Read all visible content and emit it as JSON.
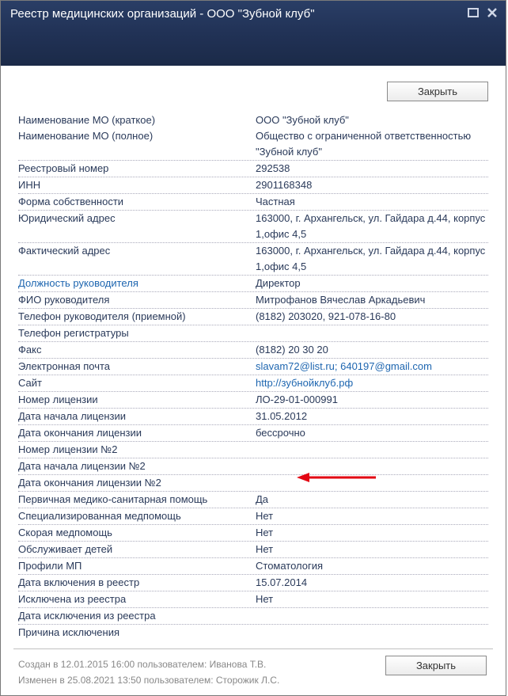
{
  "window": {
    "title": "Реестр медицинских организаций - ООО \"Зубной клуб\""
  },
  "buttons": {
    "close_top": "Закрыть",
    "close_bottom": "Закрыть"
  },
  "rows": {
    "short_name_label": "Наименование МО (краткое)",
    "short_name_value": "ООО \"Зубной клуб\"",
    "full_name_label": "Наименование МО (полное)",
    "full_name_value": "Общество с ограниченной ответственностью \"Зубной клуб\"",
    "reg_num_label": "Реестровый номер",
    "reg_num_value": "292538",
    "inn_label": "ИНН",
    "inn_value": "2901168348",
    "own_form_label": "Форма собственности",
    "own_form_value": "Частная",
    "legal_addr_label": "Юридический адрес",
    "legal_addr_value": "163000, г. Архангельск, ул. Гайдара д.44, корпус 1,офис 4,5",
    "fact_addr_label": "Фактический адрес",
    "fact_addr_value": "163000, г. Архангельск, ул. Гайдара д.44, корпус 1,офис 4,5",
    "chief_pos_label": "Должность руководителя",
    "chief_pos_value": "Директор",
    "chief_name_label": "ФИО руководителя",
    "chief_name_value": "Митрофанов Вячеслав Аркадьевич",
    "chief_phone_label": "Телефон руководителя (приемной)",
    "chief_phone_value": "(8182) 203020, 921-078-16-80",
    "reg_phone_label": "Телефон регистратуры",
    "reg_phone_value": "",
    "fax_label": "Факс",
    "fax_value": "(8182) 20 30 20",
    "email_label": "Электронная почта",
    "email_value": "slavam72@list.ru; 640197@gmail.com",
    "site_label": "Сайт",
    "site_value": "http://зубнойклуб.рф",
    "lic_num_label": "Номер лицензии",
    "lic_num_value": "ЛО-29-01-000991",
    "lic_start_label": "Дата начала лицензии",
    "lic_start_value": "31.05.2012",
    "lic_end_label": "Дата окончания лицензии",
    "lic_end_value": "бессрочно",
    "lic2_num_label": "Номер лицензии №2",
    "lic2_num_value": "",
    "lic2_start_label": "Дата начала лицензии №2",
    "lic2_start_value": "",
    "lic2_end_label": "Дата окончания лицензии №2",
    "lic2_end_value": "",
    "primary_label": "Первичная медико-санитарная помощь",
    "primary_value": "Да",
    "special_label": "Специализированная медпомощь",
    "special_value": "Нет",
    "emerg_label": "Скорая медпомощь",
    "emerg_value": "Нет",
    "kids_label": "Обслуживает детей",
    "kids_value": "Нет",
    "profiles_label": "Профили МП",
    "profiles_value": "Стоматология",
    "incl_date_label": "Дата включения в реестр",
    "incl_date_value": "15.07.2014",
    "excluded_label": "Исключена из реестра",
    "excluded_value": "Нет",
    "excl_date_label": "Дата исключения из реестра",
    "excl_date_value": "",
    "excl_reason_label": "Причина исключения",
    "excl_reason_value": ""
  },
  "footer": {
    "created": "Создан в 12.01.2015 16:00 пользователем: Иванова Т.В.",
    "modified": "Изменен в 25.08.2021 13:50 пользователем: Сторожик Л.С."
  }
}
